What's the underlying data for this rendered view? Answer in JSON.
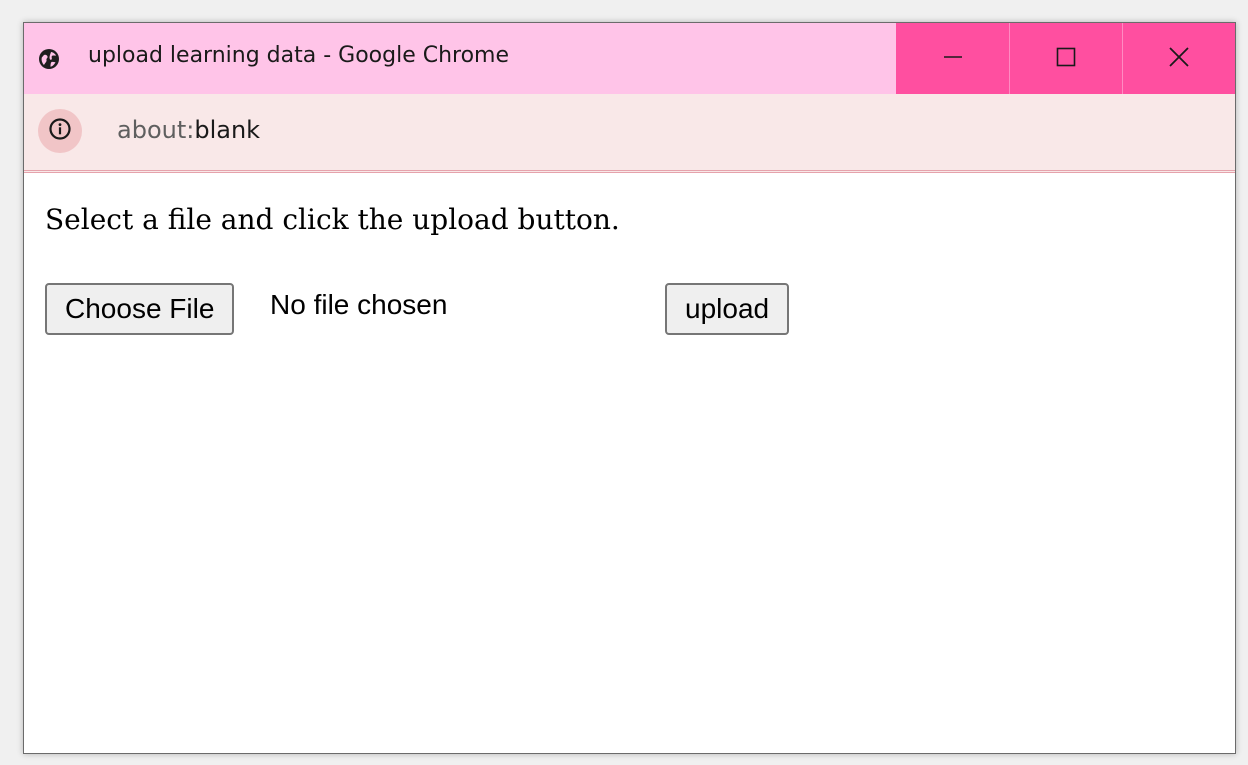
{
  "window": {
    "title": "upload learning data - Google Chrome",
    "title_icon": "globe-icon",
    "controls": {
      "minimize_icon": "minimize-icon",
      "maximize_icon": "maximize-icon",
      "close_icon": "close-icon"
    },
    "colors": {
      "titlebar": "#ffc4e8",
      "controls": "#ff4fa0",
      "addressbar": "#f9e8e8"
    }
  },
  "addressbar": {
    "icon": "info-icon",
    "url_scheme": "about:",
    "url_rest": "blank"
  },
  "page": {
    "instruction": "Select a file and click the upload button.",
    "file_input": {
      "button_label": "Choose File",
      "status": "No file chosen"
    },
    "upload_button_label": "upload"
  }
}
